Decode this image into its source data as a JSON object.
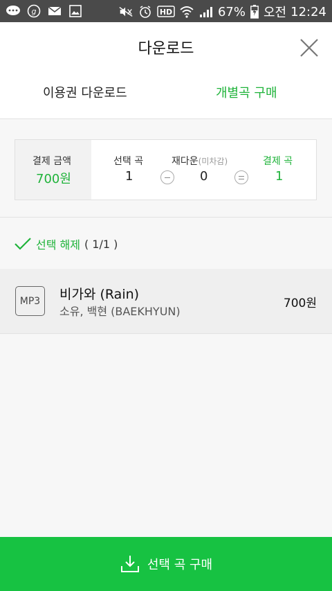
{
  "status_bar": {
    "battery": "67%",
    "ampm": "오전",
    "time": "12:24",
    "hd": "HD"
  },
  "header": {
    "title": "다운로드",
    "tabs": [
      {
        "label": "이용권 다운로드",
        "active": false
      },
      {
        "label": "개별곡 구매",
        "active": true
      }
    ]
  },
  "summary": {
    "payment_amount_label": "결제 금액",
    "payment_amount_value": "700원",
    "selected_label": "선택 곡",
    "selected_value": "1",
    "redownload_label": "재다운",
    "redownload_sub": "(미차감)",
    "redownload_value": "0",
    "paid_label": "결제 곡",
    "paid_value": "1"
  },
  "selection": {
    "label": "선택 해제",
    "count": "( 1/1 )"
  },
  "songs": [
    {
      "format": "MP3",
      "title": "비가와 (Rain)",
      "artist": "소유, 백현 (BAEKHYUN)",
      "price": "700원"
    }
  ],
  "buy_button": {
    "label": "선택 곡 구매"
  },
  "colors": {
    "accent": "#1fb33a",
    "button": "#17c242",
    "status_bar": "#4a4a4a"
  }
}
